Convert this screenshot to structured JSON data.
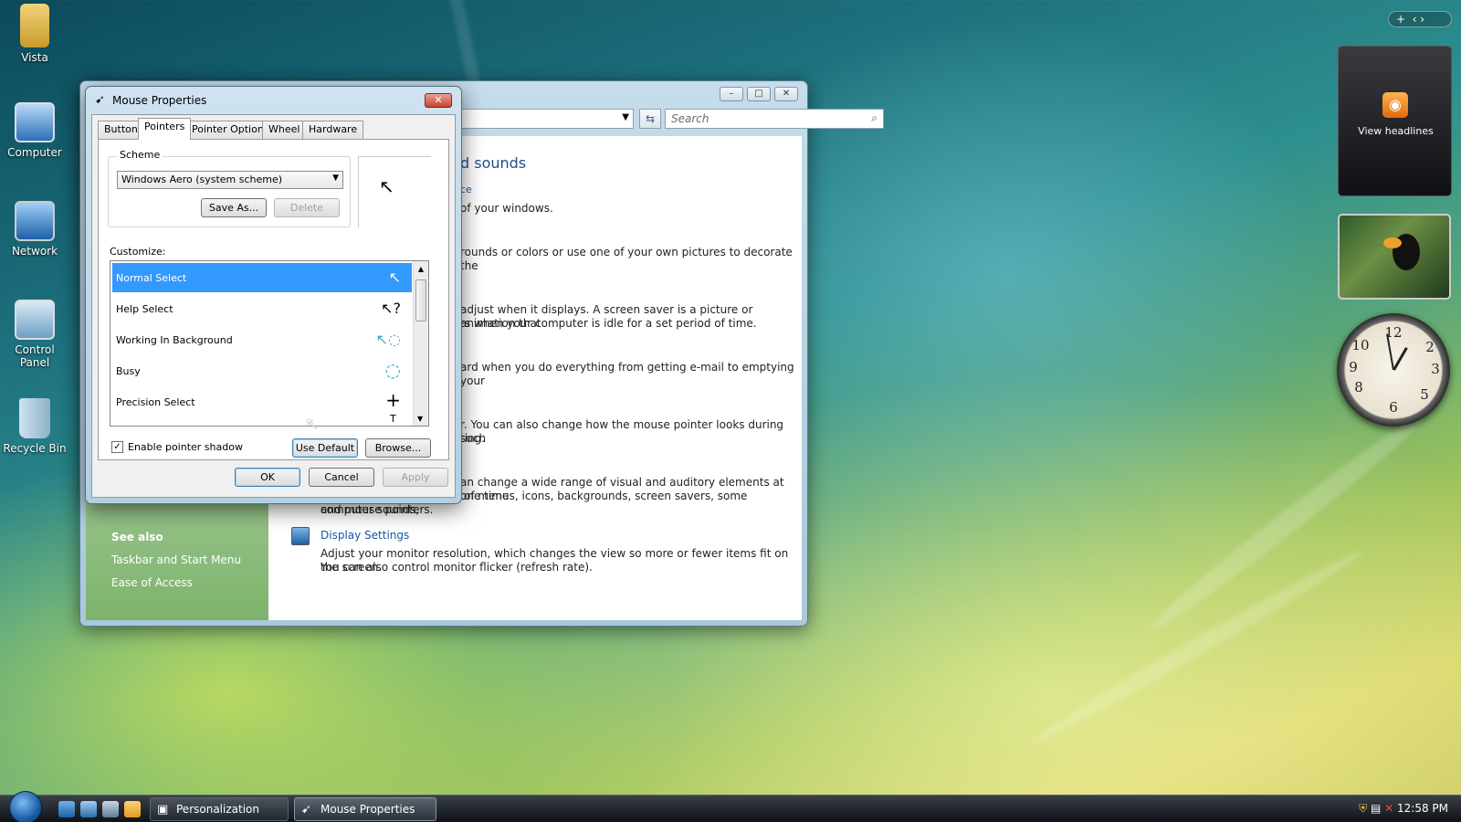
{
  "desktop": {
    "icons": [
      {
        "label": "Vista",
        "icon": "folder-icon"
      },
      {
        "label": "Computer",
        "icon": "computer-icon"
      },
      {
        "label": "Network",
        "icon": "network-icon"
      },
      {
        "label": "Control Panel",
        "icon": "control-panel-icon"
      },
      {
        "label": "Recycle Bin",
        "icon": "recycle-bin-icon"
      }
    ]
  },
  "explorer": {
    "search_placeholder": "Search",
    "heading_fragment": "d sounds",
    "link_fragment": "ce",
    "lines": [
      "of your windows.",
      "rounds or colors or use one of your own pictures to decorate the",
      "adjust when it displays. A screen saver is a picture or animation that",
      "rs when your computer is idle for a set period of time.",
      "ard when you do everything from getting e-mail to emptying your",
      "r. You can also change how the mouse pointer looks during such",
      "ting.",
      "an change a wide range of visual and auditory elements at one time",
      "including the appearance of menus, icons, backgrounds, screen savers, some computer sounds,",
      "and mouse pointers."
    ],
    "display_settings": {
      "title": "Display Settings",
      "desc1": "Adjust your monitor resolution, which changes the view so more or fewer items fit on the screen.",
      "desc2": "You can also control monitor flicker (refresh rate)."
    },
    "see_also": {
      "heading": "See also",
      "links": [
        "Taskbar and Start Menu",
        "Ease of Access"
      ]
    }
  },
  "dialog": {
    "title": "Mouse Properties",
    "tabs": [
      "Buttons",
      "Pointers",
      "Pointer Options",
      "Wheel",
      "Hardware"
    ],
    "active_tab": "Pointers",
    "scheme_label": "Scheme",
    "scheme_value": "Windows Aero (system scheme)",
    "save_as": "Save As...",
    "delete": "Delete",
    "customize_label": "Customize:",
    "pointers": [
      {
        "name": "Normal Select",
        "cursor": "↖"
      },
      {
        "name": "Help Select",
        "cursor": "↖?"
      },
      {
        "name": "Working In Background",
        "cursor": "↖◌"
      },
      {
        "name": "Busy",
        "cursor": "◌"
      },
      {
        "name": "Precision Select",
        "cursor": "+"
      }
    ],
    "selected_index": 0,
    "next_cursor_partial": "T",
    "shadow_label": "Enable pointer shadow",
    "shadow_checked": true,
    "use_default": "Use Default",
    "browse": "Browse...",
    "ok": "OK",
    "cancel": "Cancel",
    "apply": "Apply"
  },
  "sidebar": {
    "feeds": "View headlines"
  },
  "taskbar": {
    "items": [
      "Personalization",
      "Mouse Properties"
    ],
    "time": "12:58 PM"
  }
}
